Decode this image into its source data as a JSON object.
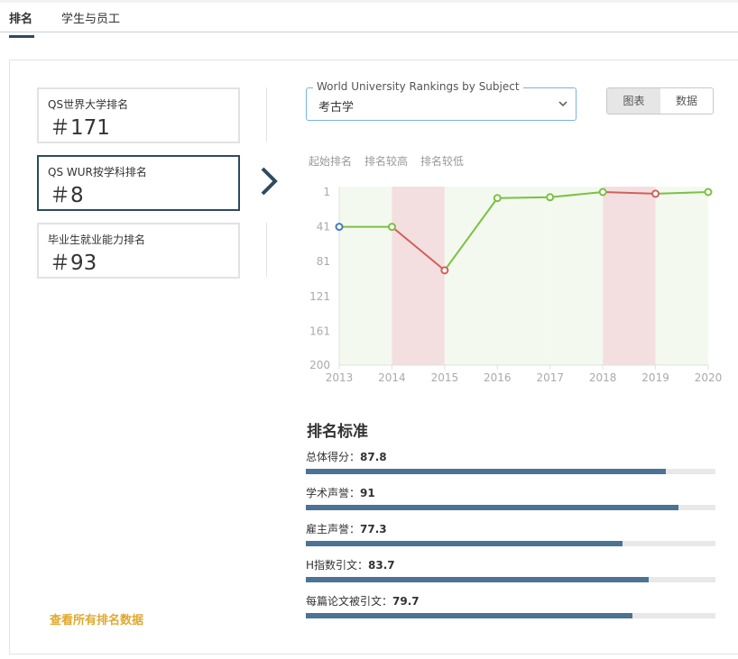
{
  "tabs": [
    {
      "label": "排名",
      "active": true
    },
    {
      "label": "学生与员工",
      "active": false
    }
  ],
  "rank_cards": [
    {
      "label": "QS世界大学排名",
      "value": "＃171",
      "active": false
    },
    {
      "label": "QS WUR按学科排名",
      "value": "＃8",
      "active": true
    },
    {
      "label": "毕业生就业能力排名",
      "value": "＃93",
      "active": false
    }
  ],
  "all_rankings_link": "查看所有排名数据",
  "subject_select": {
    "legend": "World University Rankings by Subject",
    "value": "考古学"
  },
  "view_toggle": {
    "chart": "图表",
    "data": "数据",
    "active": "chart"
  },
  "chart_legend": [
    "起始排名",
    "排名较高",
    "排名较低"
  ],
  "chart_data": {
    "type": "line",
    "x": [
      "2013",
      "2014",
      "2015",
      "2016",
      "2017",
      "2018",
      "2019",
      "2020"
    ],
    "y": [
      41,
      41,
      91,
      8,
      7,
      1,
      3,
      1
    ],
    "y_ticks": [
      "1",
      "41",
      "81",
      "121",
      "161",
      "200"
    ],
    "ylim": [
      200,
      1
    ],
    "y_inverted": true,
    "colors": {
      "up": "#7ac143",
      "down": "#d0605b",
      "start": "#4a7db5",
      "up_fill": "#f3f9ee",
      "down_fill": "#f3dfe0",
      "axis": "#e0e0e0",
      "tick": "#aaaaaa"
    }
  },
  "criteria": {
    "title": "排名标准",
    "items": [
      {
        "label": "总体得分：",
        "value": "87.8",
        "score": 87.8
      },
      {
        "label": "学术声誉：",
        "value": "91",
        "score": 91
      },
      {
        "label": "雇主声誉：",
        "value": "77.3",
        "score": 77.3
      },
      {
        "label": "H指数引文：",
        "value": "83.7",
        "score": 83.7
      },
      {
        "label": "每篇论文被引文：",
        "value": "79.7",
        "score": 79.7
      }
    ]
  }
}
